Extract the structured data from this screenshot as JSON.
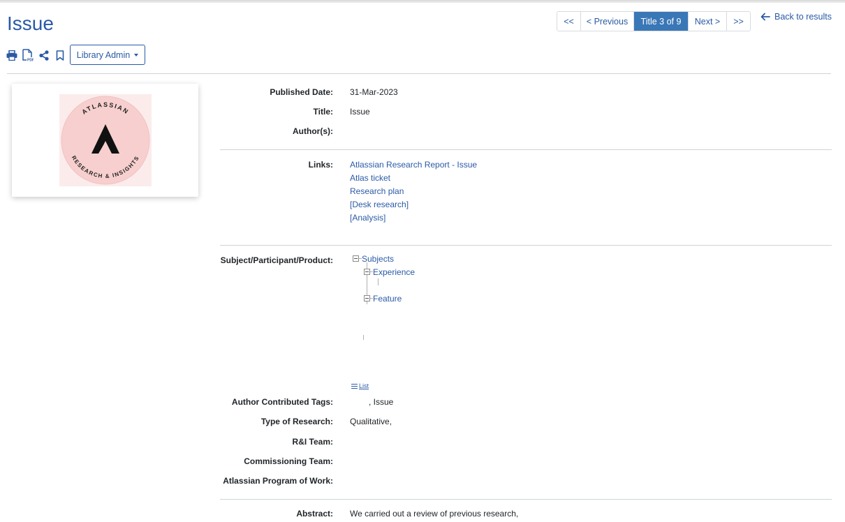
{
  "page": {
    "title": "Issue"
  },
  "toolbar": {
    "icons": [
      "print-icon",
      "pdf-icon",
      "share-icon",
      "bookmark-icon"
    ],
    "admin_label": "Library Admin"
  },
  "pager": {
    "first": "<<",
    "previous": "< Previous",
    "current": "Title 3 of 9",
    "next": "Next >",
    "last": ">>"
  },
  "back_link": "Back to results",
  "cover": {
    "logo_text_top": "ATLASSIAN",
    "logo_text_bottom": "RESEARCH & INSIGHTS",
    "logo_bg": "#f7cfcf"
  },
  "record": {
    "published_date_label": "Published Date:",
    "published_date": "31-Mar-2023",
    "title_label": "Title:",
    "title": "Issue",
    "authors_label": "Author(s):",
    "authors": "",
    "links_label": "Links:",
    "links": [
      "Atlassian Research Report - Issue",
      "Atlas ticket",
      "Research plan",
      "[Desk research]",
      "[Analysis]"
    ],
    "subject_label": "Subject/Participant/Product:",
    "tree": {
      "root": "Subjects",
      "children": [
        "Experience",
        "Feature"
      ]
    },
    "list_link": "List",
    "author_tags_label": "Author Contributed Tags:",
    "author_tags": ", Issue",
    "type_label": "Type of Research:",
    "type": "Qualitative,",
    "ri_team_label": "R&I Team:",
    "commissioning_label": "Commissioning Team:",
    "program_label": "Atlassian Program of Work:",
    "abstract_label": "Abstract:",
    "abstract": "We carried out a review of previous research,"
  },
  "colors": {
    "accent": "#2a5aa6",
    "pager_active": "#3a77b6"
  }
}
